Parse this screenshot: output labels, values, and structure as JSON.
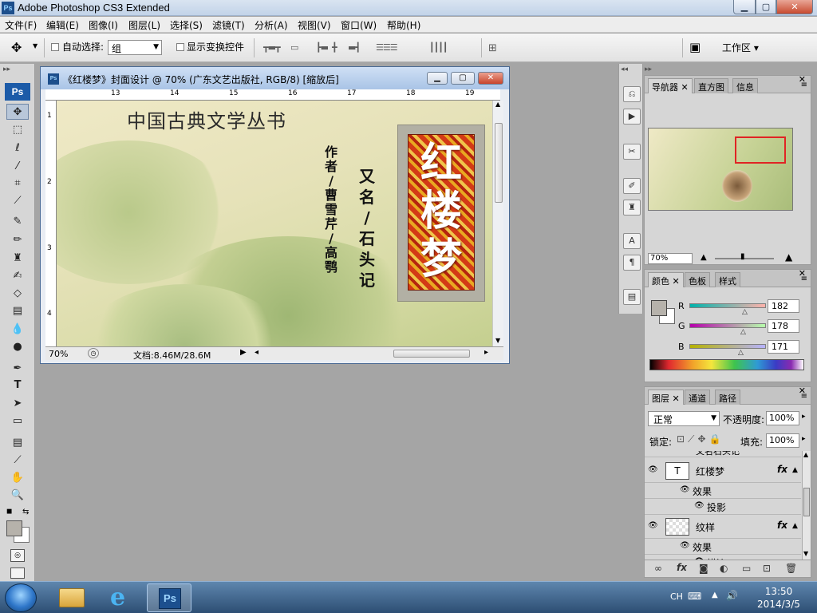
{
  "window": {
    "title": "Adobe Photoshop CS3 Extended",
    "app_icon": "Ps",
    "min": "▁",
    "max": "▢",
    "close": "✕"
  },
  "menu": [
    "文件(F)",
    "编辑(E)",
    "图像(I)",
    "图层(L)",
    "选择(S)",
    "滤镜(T)",
    "分析(A)",
    "视图(V)",
    "窗口(W)",
    "帮助(H)"
  ],
  "options": {
    "auto_select_label": "自动选择:",
    "auto_select_value": "组",
    "show_transform_label": "显示变换控件",
    "workspace_label": "工作区 ▾"
  },
  "toolbox": {
    "logo": "Ps"
  },
  "document": {
    "title": "《红楼梦》封面设计 @ 70% (广东文艺出版社, RGB/8) [缩放后]",
    "zoom": "70%",
    "file_info": "文档:8.46M/28.6M",
    "ruler_top": [
      "13",
      "14",
      "15",
      "16",
      "17",
      "18",
      "19"
    ],
    "ruler_left": [
      "1",
      "2",
      "3",
      "4"
    ],
    "cover": {
      "series": "中国古典文学丛书",
      "author_col": [
        "作",
        "者",
        "/",
        "曹",
        "雪",
        "芹",
        "/",
        "高",
        "鹗"
      ],
      "alias_col": [
        "又",
        "名",
        "/",
        "石",
        "头",
        "记"
      ],
      "book_title": [
        "红",
        "楼",
        "梦"
      ]
    }
  },
  "navigator": {
    "tabs": [
      "导航器",
      "直方图",
      "信息"
    ],
    "zoom": "70%"
  },
  "color_panel": {
    "tabs": [
      "颜色",
      "色板",
      "样式"
    ],
    "r_label": "R",
    "r_value": "182",
    "g_label": "G",
    "g_value": "178",
    "b_label": "B",
    "b_value": "171",
    "foreground": "#b6b2ab"
  },
  "layers_panel": {
    "tabs": [
      "图层",
      "通道",
      "路径"
    ],
    "blend_mode": "正常",
    "opacity_label": "不透明度:",
    "opacity_value": "100%",
    "lock_label": "锁定:",
    "fill_label": "填充:",
    "fill_value": "100%",
    "rows": {
      "partial": "又名石头记",
      "text_layer": "红楼梦",
      "effects1": "效果",
      "shadow": "投影",
      "texture_layer": "纹样",
      "effects2": "效果",
      "stroke": "描边"
    }
  },
  "taskbar": {
    "lang": "CH",
    "time": "13:50",
    "date": "2014/3/5",
    "ps_label": "Ps"
  }
}
